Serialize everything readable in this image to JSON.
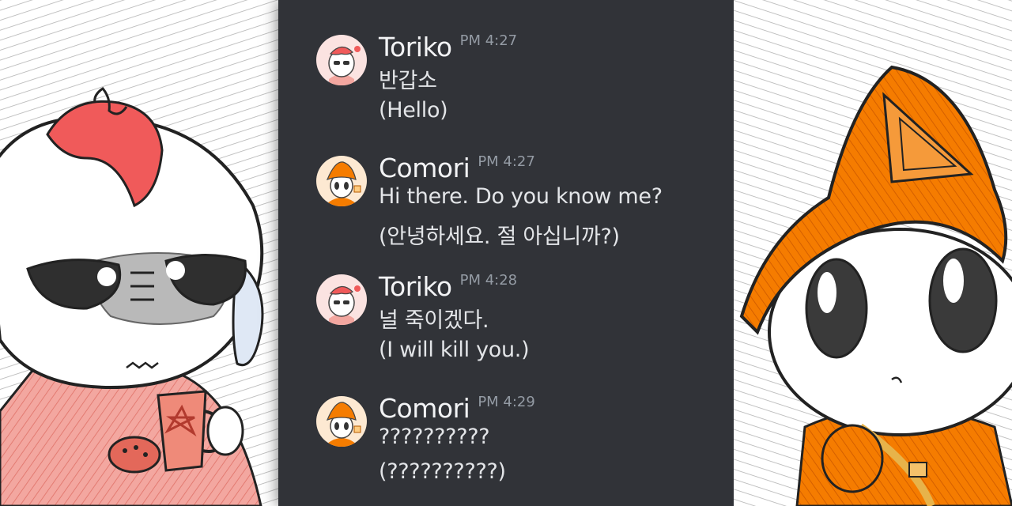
{
  "messages": [
    {
      "author": "Toriko",
      "time": "PM 4:27",
      "text": "반갑소",
      "translation": "(Hello)",
      "avatar": "toriko-avatar"
    },
    {
      "author": "Comori",
      "time": "PM 4:27",
      "text": "Hi there. Do you know me?",
      "translation": "(안녕하세요. 절 아십니까?)",
      "avatar": "comori-avatar"
    },
    {
      "author": "Toriko",
      "time": "PM 4:28",
      "text": "널 죽이겠다.",
      "translation": "(I will kill you.)",
      "avatar": "toriko-avatar"
    },
    {
      "author": "Comori",
      "time": "PM 4:29",
      "text": "??????????",
      "translation": "(??????????)",
      "avatar": "comori-avatar"
    }
  ],
  "colors": {
    "chat_background": "#313338",
    "author": "#f2f3f5",
    "timestamp": "#949ba4",
    "message_text": "#e3e5e8",
    "toriko_accent": "#f05a5a",
    "comori_accent": "#f57c00"
  }
}
